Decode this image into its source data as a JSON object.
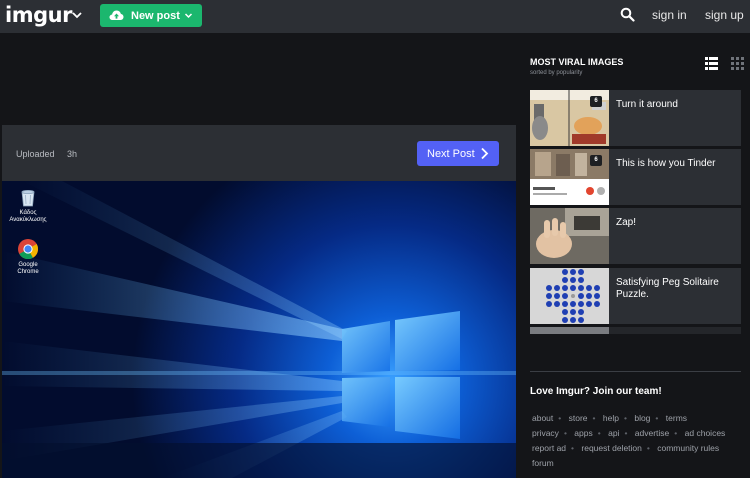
{
  "topbar": {
    "logo": "imgur",
    "new_post_label": "New post",
    "sign_in_label": "sign in",
    "sign_up_label": "sign up"
  },
  "post": {
    "uploaded_label": "Uploaded",
    "uploaded_time": "3h",
    "next_post_label": "Next Post",
    "desktop_icons": [
      {
        "label_line1": "Κάδος",
        "label_line2": "Ανακύκλωσης",
        "icon": "recycle-bin-icon"
      },
      {
        "label_line1": "Google",
        "label_line2": "Chrome",
        "icon": "chrome-icon"
      }
    ]
  },
  "sidebar": {
    "title": "MOST VIRAL IMAGES",
    "subtitle": "sorted by popularity",
    "items": [
      {
        "title": "Turn it around",
        "badge": "6"
      },
      {
        "title": "This is how you Tinder",
        "badge": "6"
      },
      {
        "title": "Zap!",
        "badge": ""
      },
      {
        "title": "Satisfying Peg Solitaire Puzzle.",
        "badge": ""
      }
    ],
    "join_title": "Love Imgur? Join our team!",
    "footer_links": [
      [
        "about",
        "store",
        "help",
        "blog",
        "terms"
      ],
      [
        "privacy",
        "apps",
        "api",
        "advertise",
        "ad choices"
      ],
      [
        "report ad",
        "request deletion",
        "community rules"
      ],
      [
        "forum"
      ]
    ]
  },
  "colors": {
    "topbar_bg": "#2c2f34",
    "page_bg": "#141518",
    "new_post_green": "#1bb76e",
    "next_post_blue": "#5361f5"
  }
}
